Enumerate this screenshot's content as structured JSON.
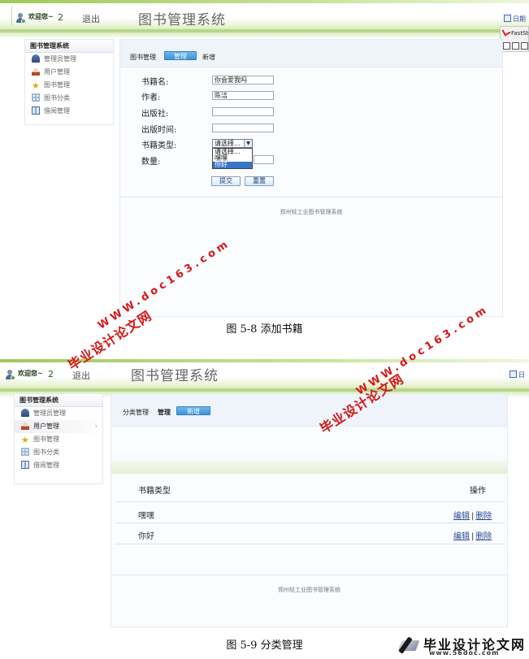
{
  "screens": [
    {
      "header": {
        "welcome": "欢迎您~",
        "user_number": "2",
        "logout": "退出",
        "system_title": "图书管理系统",
        "date_label": "日期"
      },
      "fast_stone": {
        "title": "FastSto"
      },
      "sidebar": {
        "title": "图书管理系统",
        "items": [
          {
            "label": "管理员管理",
            "icon": "admin-icon"
          },
          {
            "label": "用户管理",
            "icon": "user-icon"
          },
          {
            "label": "图书管理",
            "icon": "star-icon"
          },
          {
            "label": "图书分类",
            "icon": "grid-icon"
          },
          {
            "label": "借阅管理",
            "icon": "book-icon"
          }
        ]
      },
      "tabs": {
        "section": "图书管理",
        "manage": "管理",
        "add": "新增"
      },
      "form": {
        "name_label": "书籍名:",
        "name_value": "你会爱我吗",
        "author_label": "作者:",
        "author_value": "陈洁",
        "publisher_label": "出版社:",
        "publisher_value": "",
        "pubtime_label": "出版时间:",
        "pubtime_value": "",
        "type_label": "书籍类型:",
        "type_selected": "请选择...",
        "type_options": [
          "请选择...",
          "嘿嘿",
          "你好"
        ],
        "type_highlighted": "你好",
        "count_label": "数量:",
        "count_value": "",
        "submit": "提交",
        "reset": "重置"
      },
      "footer": "郑州轻工业图书管理系统"
    },
    {
      "header": {
        "welcome": "欢迎您~",
        "user_number": "2",
        "logout": "退出",
        "system_title": "图书管理系统",
        "date_label": "日"
      },
      "sidebar": {
        "title": "图书管理系统",
        "items": [
          {
            "label": "管理员管理",
            "icon": "admin-icon"
          },
          {
            "label": "用户管理",
            "icon": "user-icon"
          },
          {
            "label": "图书管理",
            "icon": "star-icon"
          },
          {
            "label": "图书分类",
            "icon": "grid-icon"
          },
          {
            "label": "借阅管理",
            "icon": "book-icon"
          }
        ]
      },
      "tabs": {
        "section": "分类管理",
        "manage": "管理",
        "add": "新增"
      },
      "table": {
        "col_type": "书籍类型",
        "col_ops": "操作",
        "rows": [
          {
            "type": "嘿嘿",
            "edit": "编辑",
            "sep": "|",
            "delete": "删除"
          },
          {
            "type": "你好",
            "edit": "编辑",
            "sep": "|",
            "delete": "删除"
          }
        ]
      },
      "footer": "郑州轻工业图书管理系统"
    }
  ],
  "captions": {
    "fig_5_8": "图 5-8 添加书籍",
    "fig_5_9": "图 5-9 分类管理"
  },
  "watermarks": {
    "cn": "毕业设计论文网",
    "url": "WWW.doc163.com"
  },
  "corner_logo": {
    "title": "毕业设计论文网",
    "url": "www.56doc.com"
  },
  "colors": {
    "accent": "#3f92d4",
    "header_green": "#b7d68a",
    "watermark": "#d41818"
  }
}
